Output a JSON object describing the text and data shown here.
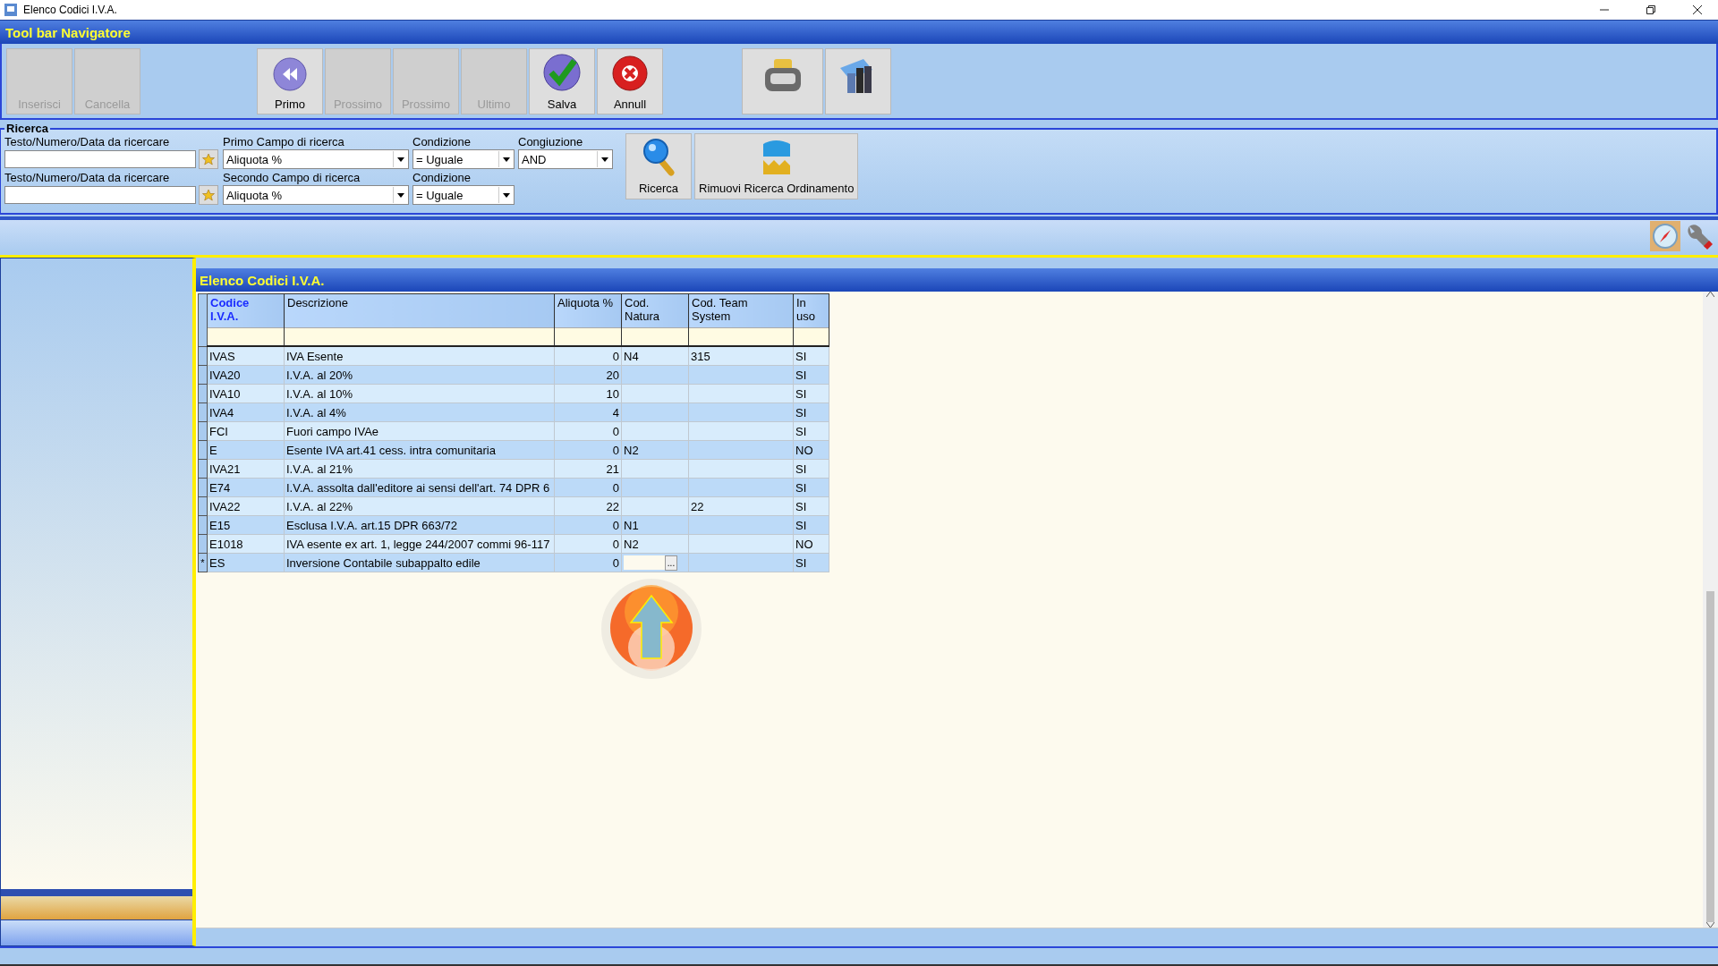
{
  "window": {
    "title": "Elenco Codici I.V.A."
  },
  "toolbar": {
    "title": "Tool bar Navigatore",
    "groups": [
      [
        {
          "label": "Inserisci",
          "disabled": true,
          "kind": "plain"
        },
        {
          "label": "Cancella",
          "disabled": true,
          "kind": "plain"
        }
      ],
      [
        {
          "label": "Primo",
          "disabled": false,
          "kind": "rewind"
        },
        {
          "label": "Prossimo",
          "disabled": true,
          "kind": "plain"
        },
        {
          "label": "Prossimo",
          "disabled": true,
          "kind": "plain"
        },
        {
          "label": "Ultimo",
          "disabled": true,
          "kind": "plain"
        },
        {
          "label": "Salva",
          "disabled": false,
          "kind": "check"
        },
        {
          "label": "Annull",
          "disabled": false,
          "kind": "cross"
        }
      ],
      [
        {
          "disabled": false,
          "kind": "printer"
        },
        {
          "disabled": false,
          "kind": "books"
        }
      ]
    ]
  },
  "search": {
    "title": "Ricerca",
    "rows": [
      {
        "text_label": "Testo/Numero/Data da ricercare",
        "field_label": "Primo Campo di ricerca",
        "field": "Aliquota %",
        "condition_label": "Condizione",
        "condition": "= Uguale",
        "conjunction_label": "Congiuzione",
        "conjunction": "AND"
      },
      {
        "text_label": "Testo/Numero/Data da ricercare",
        "field_label": "Secondo Campo di ricerca",
        "field": "Aliquota %",
        "condition_label": "Condizione",
        "condition": "= Uguale"
      }
    ],
    "buttons": [
      {
        "label": "Ricerca",
        "kind": "search"
      },
      {
        "label": "Rimuovi Ricerca Ordinamento",
        "kind": "clear"
      }
    ]
  },
  "grid": {
    "title": "Elenco Codici I.V.A.",
    "columns": [
      {
        "label": "Codice\nI.V.A.",
        "sorted": true,
        "kind": "text"
      },
      {
        "label": "Descrizione",
        "sorted": false,
        "kind": "text"
      },
      {
        "label": "Aliquota %",
        "sorted": false,
        "kind": "number"
      },
      {
        "label": "Cod.\nNatura",
        "sorted": false,
        "kind": "text"
      },
      {
        "label": "Cod. Team\nSystem",
        "sorted": false,
        "kind": "text"
      },
      {
        "label": "In\nuso",
        "sorted": false,
        "kind": "text"
      }
    ],
    "rows": [
      {
        "cells": [
          "IVAS",
          "IVA Esente",
          "0",
          "N4",
          "315",
          "SI"
        ]
      },
      {
        "cells": [
          "IVA20",
          "I.V.A. al 20%",
          "20",
          null,
          null,
          "SI"
        ]
      },
      {
        "cells": [
          "IVA10",
          "I.V.A. al 10%",
          "10",
          null,
          null,
          "SI"
        ]
      },
      {
        "cells": [
          "IVA4",
          "I.V.A. al 4%",
          "4",
          null,
          null,
          "SI"
        ]
      },
      {
        "cells": [
          "FCI",
          "Fuori campo IVAe",
          "0",
          null,
          null,
          "SI"
        ]
      },
      {
        "cells": [
          "E",
          "Esente IVA art.41 cess. intra comunitaria",
          "0",
          "N2",
          null,
          "NO"
        ]
      },
      {
        "cells": [
          "IVA21",
          "I.V.A. al 21%",
          "21",
          null,
          null,
          "SI"
        ]
      },
      {
        "cells": [
          "E74",
          "I.V.A. assolta dall'editore ai sensi dell'art. 74 DPR 6",
          "0",
          null,
          null,
          "SI"
        ]
      },
      {
        "cells": [
          "IVA22",
          "I.V.A. al 22%",
          "22",
          null,
          "22",
          "SI"
        ]
      },
      {
        "cells": [
          "E15",
          "Esclusa I.V.A. art.15 DPR 663/72",
          "0",
          "N1",
          null,
          "SI"
        ]
      },
      {
        "cells": [
          "E1018",
          "IVA esente ex art. 1, legge 244/2007 commi 96-117",
          "0",
          "N2",
          null,
          "NO"
        ]
      },
      {
        "marker": "*",
        "cells": [
          "ES",
          "Inversione Contabile subappalto edile",
          "0",
          {
            "kind": "editor",
            "button": "..."
          },
          null,
          "SI"
        ]
      }
    ]
  }
}
